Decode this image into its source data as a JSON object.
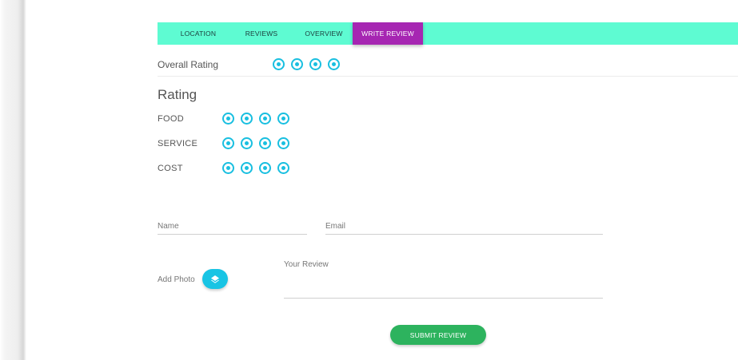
{
  "tabs": [
    {
      "label": "LOCATION"
    },
    {
      "label": "REVIEWS"
    },
    {
      "label": "OVERVIEW"
    },
    {
      "label": "WRITE REVIEW",
      "active": true
    }
  ],
  "overall": {
    "label": "Overall Rating",
    "icon_count": 4,
    "icon": "radio-dot-icon"
  },
  "rating": {
    "heading": "Rating",
    "rows": [
      {
        "label": "FOOD",
        "icon_count": 4
      },
      {
        "label": "SERVICE",
        "icon_count": 4
      },
      {
        "label": "COST",
        "icon_count": 4
      }
    ]
  },
  "form": {
    "name_label": "Name",
    "email_label": "Email",
    "review_label": "Your Review",
    "add_photo_label": "Add Photo",
    "add_photo_icon": "layers-icon",
    "submit_label": "SUBMIT REVIEW"
  },
  "colors": {
    "tab_bar": "#5efbd2",
    "active_tab": "#a626b2",
    "rating_icon": "#19bfe0",
    "submit": "#2db35e"
  }
}
